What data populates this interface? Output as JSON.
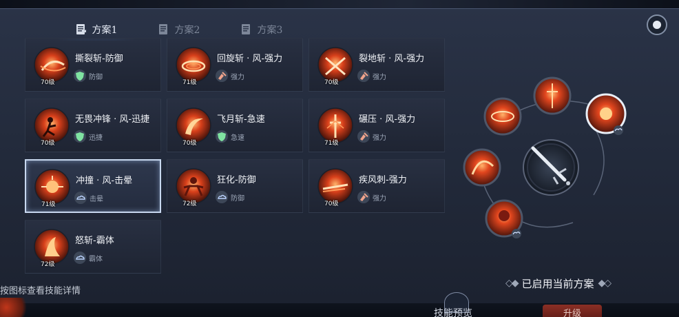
{
  "tabs": [
    {
      "label": "方案1",
      "active": true
    },
    {
      "label": "方案2",
      "active": false
    },
    {
      "label": "方案3",
      "active": false
    }
  ],
  "skills": [
    {
      "name": "撕裂斩-防御",
      "level": "70级",
      "tag": "防御",
      "tag_icon": "shield-icon",
      "art": "slash-swirl",
      "selected": false
    },
    {
      "name": "回旋斩 · 风-强力",
      "level": "71级",
      "tag": "强力",
      "tag_icon": "fist-icon",
      "art": "spin-ring",
      "selected": false
    },
    {
      "name": "裂地斩 · 风-强力",
      "level": "70级",
      "tag": "强力",
      "tag_icon": "fist-icon",
      "art": "cross-slash",
      "selected": false
    },
    {
      "name": "无畏冲锋 · 风-迅捷",
      "level": "70级",
      "tag": "迅捷",
      "tag_icon": "shield-icon",
      "art": "dash-figure",
      "selected": false
    },
    {
      "name": "飞月斩-急速",
      "level": "70级",
      "tag": "急速",
      "tag_icon": "shield-icon",
      "art": "crescent",
      "selected": false
    },
    {
      "name": "碾压 · 风-强力",
      "level": "71级",
      "tag": "强力",
      "tag_icon": "fist-icon",
      "art": "sword-burst",
      "selected": false
    },
    {
      "name": "冲撞 · 风-击晕",
      "level": "71级",
      "tag": "击晕",
      "tag_icon": "cloud-icon",
      "art": "fist-impact",
      "selected": true
    },
    {
      "name": "狂化-防御",
      "level": "72级",
      "tag": "防御",
      "tag_icon": "cloud-icon",
      "art": "berserk",
      "selected": false
    },
    {
      "name": "疾风刺-强力",
      "level": "70级",
      "tag": "强力",
      "tag_icon": "fist-icon",
      "art": "thrust",
      "selected": false
    },
    {
      "name": "怒斩-霸体",
      "level": "72级",
      "tag": "霸体",
      "tag_icon": "cloud-icon",
      "art": "flame-slash",
      "selected": false
    }
  ],
  "hint": "按图标查看技能详情",
  "status": "已启用当前方案",
  "bottom": {
    "preview_label": "技能预览",
    "upgrade_label": "升级"
  },
  "colors": {
    "accent_blue": "#5aa6ff",
    "skill_red": "#c0361a",
    "panel_bg": "#232b3c"
  }
}
